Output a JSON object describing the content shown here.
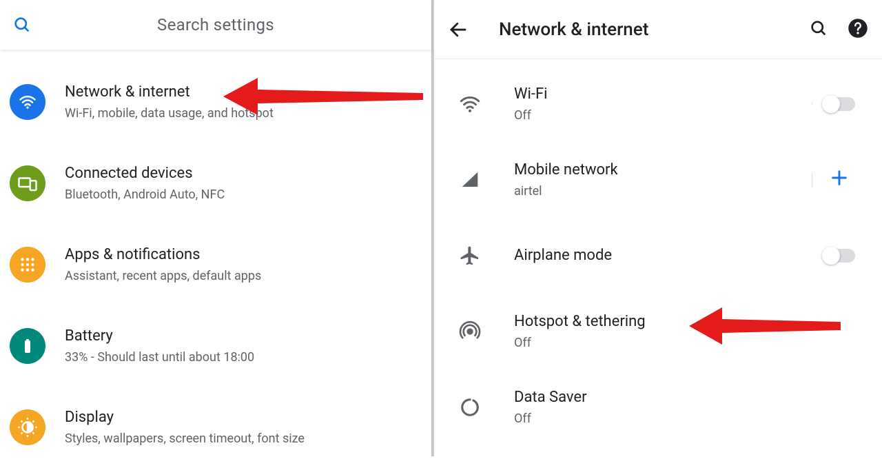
{
  "left": {
    "search_placeholder": "Search settings",
    "items": [
      {
        "title": "Network & internet",
        "subtitle": "Wi-Fi, mobile, data usage, and hotspot"
      },
      {
        "title": "Connected devices",
        "subtitle": "Bluetooth, Android Auto, NFC"
      },
      {
        "title": "Apps & notifications",
        "subtitle": "Assistant, recent apps, default apps"
      },
      {
        "title": "Battery",
        "subtitle": "33% - Should last until about 18:00"
      },
      {
        "title": "Display",
        "subtitle": "Styles, wallpapers, screen timeout, font size"
      }
    ]
  },
  "right": {
    "title": "Network & internet",
    "items": [
      {
        "title": "Wi-Fi",
        "subtitle": "Off",
        "action": "switch"
      },
      {
        "title": "Mobile network",
        "subtitle": "airtel",
        "action": "plus"
      },
      {
        "title": "Airplane mode",
        "subtitle": "",
        "action": "switch"
      },
      {
        "title": "Hotspot & tethering",
        "subtitle": "Off",
        "action": "none"
      },
      {
        "title": "Data Saver",
        "subtitle": "Off",
        "action": "none"
      }
    ]
  }
}
